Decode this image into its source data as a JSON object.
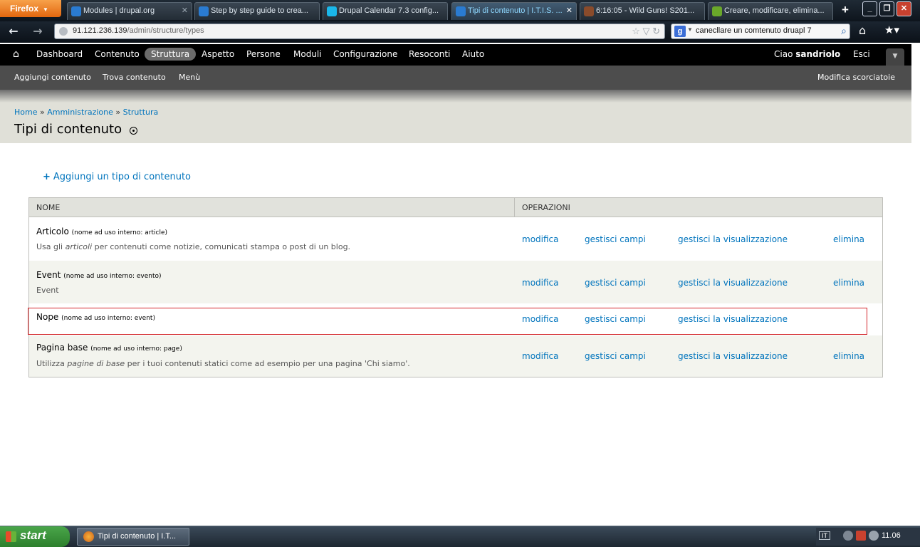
{
  "browser": {
    "menu_label": "Firefox",
    "tabs": [
      {
        "label": "Modules | drupal.org",
        "color": "#2a7bd1"
      },
      {
        "label": "Step by step guide to crea...",
        "color": "#2a7bd1"
      },
      {
        "label": "Drupal Calendar 7.3 config...",
        "color": "#1ab7ea"
      },
      {
        "label": "Tipi di contenuto | I.T.I.S. ...",
        "color": "#2a7bd1"
      },
      {
        "label": "6:16:05 - Wild Guns! S201...",
        "color": "#8a4b2b"
      },
      {
        "label": "Creare, modificare, elimina...",
        "color": "#6aa82a"
      }
    ],
    "url_host": "91.121.236.139",
    "url_path": "/admin/structure/types",
    "search_value": "canecllare un comtenuto druapl 7"
  },
  "toolbar": {
    "items": [
      "Dashboard",
      "Contenuto",
      "Struttura",
      "Aspetto",
      "Persone",
      "Moduli",
      "Configurazione",
      "Resoconti",
      "Aiuto"
    ],
    "greeting": "Ciao ",
    "username": "sandriolo",
    "logout": "Esci"
  },
  "shortcuts": {
    "items": [
      "Aggiungi contenuto",
      "Trova contenuto",
      "Menù"
    ],
    "edit": "Modifica scorciatoie"
  },
  "breadcrumb": [
    "Home",
    "Amministrazione",
    "Struttura"
  ],
  "breadcrumb_sep": "»",
  "page_title": "Tipi di contenuto",
  "add_link": "Aggiungi un tipo di contenuto",
  "table": {
    "headers": [
      "Nome",
      "Operazioni"
    ],
    "rows": [
      {
        "name": "Articolo",
        "machine": "(nome ad uso interno: article)",
        "desc_pre": "Usa gli ",
        "desc_em": "articoli",
        "desc_post": " per contenuti come notizie, comunicati stampa o post di un blog.",
        "ops": [
          "modifica",
          "gestisci campi",
          "gestisci la visualizzazione",
          "elimina"
        ]
      },
      {
        "name": "Event",
        "machine": "(nome ad uso interno: evento)",
        "desc_pre": "Event",
        "desc_em": "",
        "desc_post": "",
        "ops": [
          "modifica",
          "gestisci campi",
          "gestisci la visualizzazione",
          "elimina"
        ]
      },
      {
        "name": "Nope",
        "machine": "(nome ad uso interno: event)",
        "desc_pre": "",
        "desc_em": "",
        "desc_post": "",
        "ops": [
          "modifica",
          "gestisci campi",
          "gestisci la visualizzazione",
          ""
        ]
      },
      {
        "name": "Pagina base",
        "machine": "(nome ad uso interno: page)",
        "desc_pre": "Utilizza ",
        "desc_em": "pagine di base",
        "desc_post": " per i tuoi contenuti statici come ad esempio per una pagina 'Chi siamo'.",
        "ops": [
          "modifica",
          "gestisci campi",
          "gestisci la visualizzazione",
          "elimina"
        ]
      }
    ]
  },
  "taskbar": {
    "start": "start",
    "task": "Tipi di contenuto | I.T...",
    "lang": "IT",
    "clock": "11.06"
  }
}
